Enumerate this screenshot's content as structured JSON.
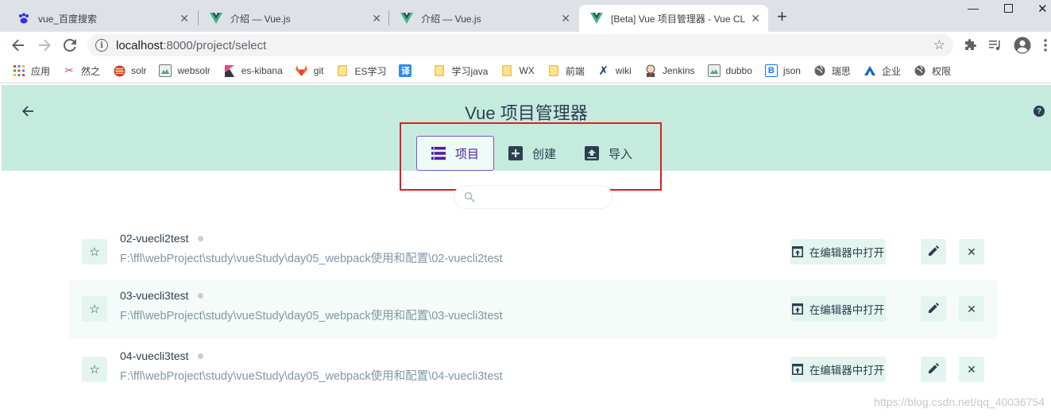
{
  "browser": {
    "tabs": [
      {
        "title": "vue_百度搜索",
        "icon": "baidu-paw-icon",
        "active": false
      },
      {
        "title": "介绍 — Vue.js",
        "icon": "vue-logo-icon",
        "active": false
      },
      {
        "title": "介绍 — Vue.js",
        "icon": "vue-logo-icon",
        "active": false
      },
      {
        "title": "[Beta] Vue 项目管理器 - Vue CLI",
        "icon": "vue-logo-icon",
        "active": true
      }
    ],
    "url_host": "localhost",
    "url_rest": ":8000/project/select",
    "bookmarks": [
      {
        "label": "应用",
        "icon": "apps-grid-icon"
      },
      {
        "label": "然之",
        "icon": "ranzhi-logo-icon"
      },
      {
        "label": "solr",
        "icon": "solr-logo-icon"
      },
      {
        "label": "websolr",
        "icon": "websolr-logo-icon"
      },
      {
        "label": "es-kibana",
        "icon": "kibana-logo-icon"
      },
      {
        "label": "git",
        "icon": "gitlab-logo-icon"
      },
      {
        "label": "ES学习",
        "icon": "folder-icon"
      },
      {
        "label": "",
        "icon": "translate-icon"
      },
      {
        "label": "学习java",
        "icon": "folder-icon"
      },
      {
        "label": "WX",
        "icon": "folder-icon"
      },
      {
        "label": "前端",
        "icon": "folder-icon"
      },
      {
        "label": "wiki",
        "icon": "wiki-logo-icon"
      },
      {
        "label": "Jenkins",
        "icon": "jenkins-logo-icon"
      },
      {
        "label": "dubbo",
        "icon": "dubbo-logo-icon"
      },
      {
        "label": "json",
        "icon": "json-logo-icon"
      },
      {
        "label": "瑞思",
        "icon": "globe-icon"
      },
      {
        "label": "企业",
        "icon": "enterprise-logo-icon"
      },
      {
        "label": "权限",
        "icon": "globe-icon"
      }
    ],
    "translate_glyph": "译"
  },
  "app": {
    "title": "Vue 项目管理器",
    "help_glyph": "?",
    "nav_tabs": [
      {
        "label": "项目",
        "icon": "list-icon",
        "active": true
      },
      {
        "label": "创建",
        "icon": "add-box-icon",
        "active": false
      },
      {
        "label": "导入",
        "icon": "unarchive-icon",
        "active": false
      }
    ],
    "search_placeholder": "",
    "open_label": "在编辑器中打开",
    "projects": [
      {
        "name": "02-vuecli2test",
        "path": "F:\\ffl\\webProject\\study\\vueStudy\\day05_webpack使用和配置\\02-vuecli2test"
      },
      {
        "name": "03-vuecli3test",
        "path": "F:\\ffl\\webProject\\study\\vueStudy\\day05_webpack使用和配置\\03-vuecli3test"
      },
      {
        "name": "04-vuecli3test",
        "path": "F:\\ffl\\webProject\\study\\vueStudy\\day05_webpack使用和配置\\04-vuecli3test"
      }
    ]
  },
  "watermark": "https://blog.csdn.net/qq_40036754",
  "colors": {
    "header_bg": "#c5ebdf",
    "accent_purple": "#4f1fa2",
    "highlight_red": "#e31b23",
    "text_dark": "#2c3e50",
    "path_text": "#7f96a8"
  }
}
